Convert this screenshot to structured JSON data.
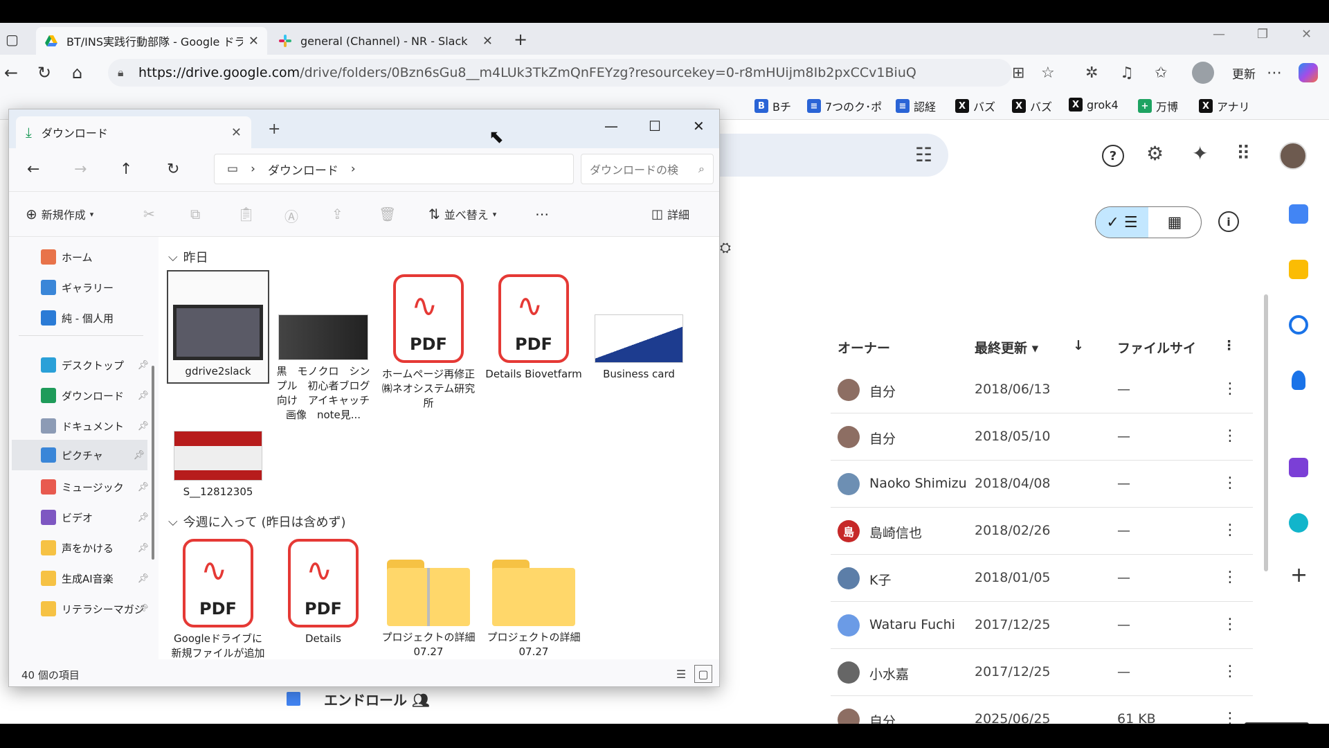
{
  "browser": {
    "tabs": [
      {
        "title": "BT/INS実践行動部隊 - Google ドラ"
      },
      {
        "title": "general (Channel) - NR - Slack"
      }
    ],
    "url_host": "https://drive.google.com",
    "url_path": "/drive/folders/0Bzn6sGu8__m4LUk3TkZmQnFEYzg?resourcekey=0-r8mHUijm8Ib2pxCCv1BiuQ",
    "update_label": "更新",
    "bookmarks": [
      "Bチ",
      "7つのク･ポ",
      "認経",
      "バズ",
      "バズ",
      "grok4",
      "万博",
      "アナリ"
    ]
  },
  "drive": {
    "headers": {
      "owner": "オーナー",
      "modified": "最終更新",
      "size": "ファイルサイ"
    },
    "rows": [
      {
        "owner": "自分",
        "date": "2018/06/13",
        "size": "—",
        "avatar": "#8d6e63",
        "init": ""
      },
      {
        "owner": "自分",
        "date": "2018/05/10",
        "size": "—",
        "avatar": "#8d6e63",
        "init": ""
      },
      {
        "owner": "Naoko Shimizu",
        "date": "2018/04/08",
        "size": "—",
        "avatar": "#6d8fb3",
        "init": ""
      },
      {
        "owner": "島崎信也",
        "date": "2018/02/26",
        "size": "—",
        "avatar": "#c62828",
        "init": "島"
      },
      {
        "owner": "K子",
        "date": "2018/01/05",
        "size": "—",
        "avatar": "#5c7ea8",
        "init": ""
      },
      {
        "owner": "Wataru Fuchi",
        "date": "2017/12/25",
        "size": "—",
        "avatar": "#6b9be6",
        "init": ""
      },
      {
        "owner": "小水嘉",
        "date": "2017/12/25",
        "size": "—",
        "avatar": "#666666",
        "init": ""
      },
      {
        "owner": "自分",
        "date": "2025/06/25",
        "size": "61 KB",
        "avatar": "#8d6e63",
        "init": ""
      }
    ],
    "bottom_file": "エンドロール"
  },
  "explorer": {
    "tab_title": "ダウンロード",
    "path": "ダウンロード",
    "search_placeholder": "ダウンロードの検",
    "commands": {
      "new": "新規作成",
      "sort": "並べ替え",
      "details": "詳細"
    },
    "nav": [
      {
        "label": "ホーム",
        "color": "#e8734a",
        "pin": false
      },
      {
        "label": "ギャラリー",
        "color": "#3a86d8",
        "pin": false
      },
      {
        "label": "純 - 個人用",
        "color": "#2b7bd6",
        "pin": false
      },
      {
        "label": "デスクトップ",
        "color": "#2aa0d8",
        "pin": true
      },
      {
        "label": "ダウンロード",
        "color": "#1f9b5a",
        "pin": true
      },
      {
        "label": "ドキュメント",
        "color": "#8c9bb5",
        "pin": true
      },
      {
        "label": "ピクチャ",
        "color": "#3a86d8",
        "pin": true
      },
      {
        "label": "ミュージック",
        "color": "#e85a4f",
        "pin": true
      },
      {
        "label": "ビデオ",
        "color": "#7e57c2",
        "pin": true
      },
      {
        "label": "声をかける",
        "color": "#f6c244",
        "pin": true
      },
      {
        "label": "生成AI音楽",
        "color": "#f6c244",
        "pin": true
      },
      {
        "label": "リテラシーマガジ",
        "color": "#f6c244",
        "pin": true
      }
    ],
    "group_yesterday": "昨日",
    "group_thisweek": "今週に入って (昨日は含めず)",
    "files_yesterday": [
      {
        "name": "gdrive2slack",
        "type": "video"
      },
      {
        "name": "黒　モノクロ　シンプル　初心者ブログ向け　アイキャッチ画像　note見...",
        "type": "image"
      },
      {
        "name": "ホームページ再修正㈱ネオシステム研究所",
        "type": "pdf"
      },
      {
        "name": "Details Biovetfarm",
        "type": "pdf"
      },
      {
        "name": "Business card",
        "type": "card"
      },
      {
        "name": "S__12812305",
        "type": "photo"
      }
    ],
    "files_week": [
      {
        "name": "Googleドライブに新規ファイルが追加",
        "type": "pdf"
      },
      {
        "name": "Details",
        "type": "pdf"
      },
      {
        "name": "プロジェクトの詳細 07.27",
        "type": "zip"
      },
      {
        "name": "プロジェクトの詳細 07.27",
        "type": "folder"
      }
    ],
    "status": "40 個の項目"
  }
}
